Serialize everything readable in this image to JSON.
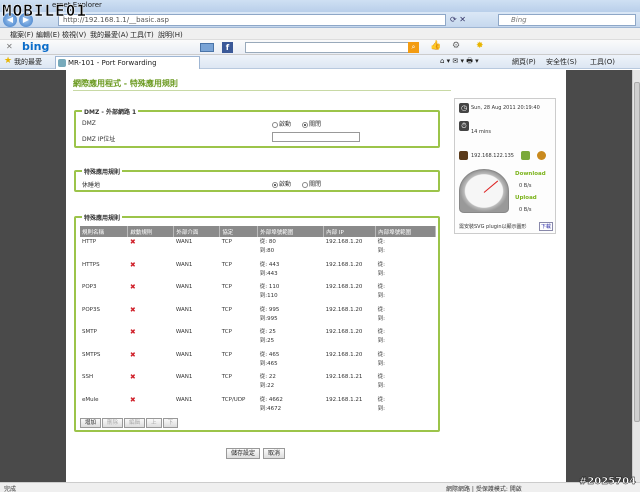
{
  "window": {
    "title": "MR-101 - Port Forwarding - Windows Internet Explorer",
    "title_visible": "ernet Explorer",
    "logo": "MOBILE01"
  },
  "addressbar": {
    "url": "http://192.168.1.1/__basic.asp",
    "search_placeholder": "Bing"
  },
  "menu": [
    "檔案(F)",
    "編輯(E)",
    "檢視(V)",
    "我的最愛(A)",
    "工具(T)",
    "說明(H)"
  ],
  "bing": {
    "logo": "bing"
  },
  "favorites": {
    "label": "我的最愛",
    "tab_title": "MR-101 - Port Forwarding",
    "tools": [
      "網頁(P)",
      "安全性(S)",
      "工具(O)"
    ]
  },
  "page": {
    "title": "網際應用程式 - 特殊應用規則",
    "dmz": {
      "legend": "DMZ - 外部網路 1",
      "dmz_label": "DMZ",
      "on": "啟動",
      "off": "關閉",
      "ip_label": "DMZ IP位址",
      "ip_value": "",
      "selected": "off"
    },
    "special": {
      "legend": "特殊應用規則",
      "switch_label": "休睡地",
      "on": "啟動",
      "off": "關閉",
      "selected": "on"
    },
    "rules": {
      "legend": "特殊應用規則",
      "headers": [
        "規則名稱",
        "啟動規則",
        "外部介面",
        "協定",
        "外部埠號範圍",
        "內部 IP",
        "內部埠號範圍"
      ],
      "rows": [
        {
          "name": "HTTP",
          "iface": "WAN1",
          "proto": "TCP",
          "from": "從: 80",
          "to": "到:80",
          "ip": "192.168.1.20",
          "in_from": "從:",
          "in_to": "到:"
        },
        {
          "name": "HTTPS",
          "iface": "WAN1",
          "proto": "TCP",
          "from": "從: 443",
          "to": "到:443",
          "ip": "192.168.1.20",
          "in_from": "從:",
          "in_to": "到:"
        },
        {
          "name": "POP3",
          "iface": "WAN1",
          "proto": "TCP",
          "from": "從: 110",
          "to": "到:110",
          "ip": "192.168.1.20",
          "in_from": "從:",
          "in_to": "到:"
        },
        {
          "name": "POP3S",
          "iface": "WAN1",
          "proto": "TCP",
          "from": "從: 995",
          "to": "到:995",
          "ip": "192.168.1.20",
          "in_from": "從:",
          "in_to": "到:"
        },
        {
          "name": "SMTP",
          "iface": "WAN1",
          "proto": "TCP",
          "from": "從: 25",
          "to": "到:25",
          "ip": "192.168.1.20",
          "in_from": "從:",
          "in_to": "到:"
        },
        {
          "name": "SMTPS",
          "iface": "WAN1",
          "proto": "TCP",
          "from": "從: 465",
          "to": "到:465",
          "ip": "192.168.1.20",
          "in_from": "從:",
          "in_to": "到:"
        },
        {
          "name": "SSH",
          "iface": "WAN1",
          "proto": "TCP",
          "from": "從: 22",
          "to": "到:22",
          "ip": "192.168.1.21",
          "in_from": "從:",
          "in_to": "到:"
        },
        {
          "name": "eMule",
          "iface": "WAN1",
          "proto": "TCP/UDP",
          "from": "從: 4662",
          "to": "到:4672",
          "ip": "192.168.1.21",
          "in_from": "從:",
          "in_to": "到:"
        }
      ],
      "buttons": [
        "增加",
        "刪除",
        "編輯",
        "上",
        "下"
      ]
    },
    "save": "儲存設定",
    "cancel": "取消"
  },
  "side": {
    "datetime": "Sun, 28 Aug 2011 20:19:40",
    "uptime": "14 mins",
    "ip": "192.168.122.135",
    "download_label": "Download",
    "download_value": "0 B/s",
    "upload_label": "Upload",
    "upload_value": "0 B/s",
    "plugin_text": "需安裝SVG plugin以顯示圖形",
    "plugin_link": "下載"
  },
  "statusbar": {
    "left": "完成",
    "zone": "網際網路 | 受保護模式: 開啟"
  },
  "watermark": "#2025704"
}
